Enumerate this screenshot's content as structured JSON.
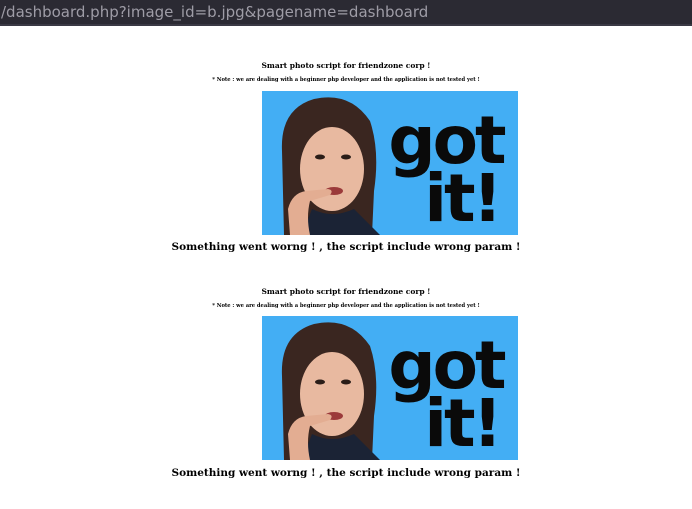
{
  "browser": {
    "url": "/dashboard.php?image_id=b.jpg&pagename=dashboard"
  },
  "blocks": [
    {
      "heading": "Smart photo script for friendzone corp !",
      "note": "* Note : we are dealing with a beginner php developer and the application is not tested yet !",
      "image": {
        "text_line1": "got",
        "text_line2": "it!",
        "background": "#43aef4"
      },
      "error": "Something went worng ! , the script include wrong param !"
    },
    {
      "heading": "Smart photo script for friendzone corp !",
      "note": "* Note : we are dealing with a beginner php developer and the application is not tested yet !",
      "image": {
        "text_line1": "got",
        "text_line2": "it!",
        "background": "#43aef4"
      },
      "error": "Something went worng ! , the script include wrong param !"
    }
  ]
}
